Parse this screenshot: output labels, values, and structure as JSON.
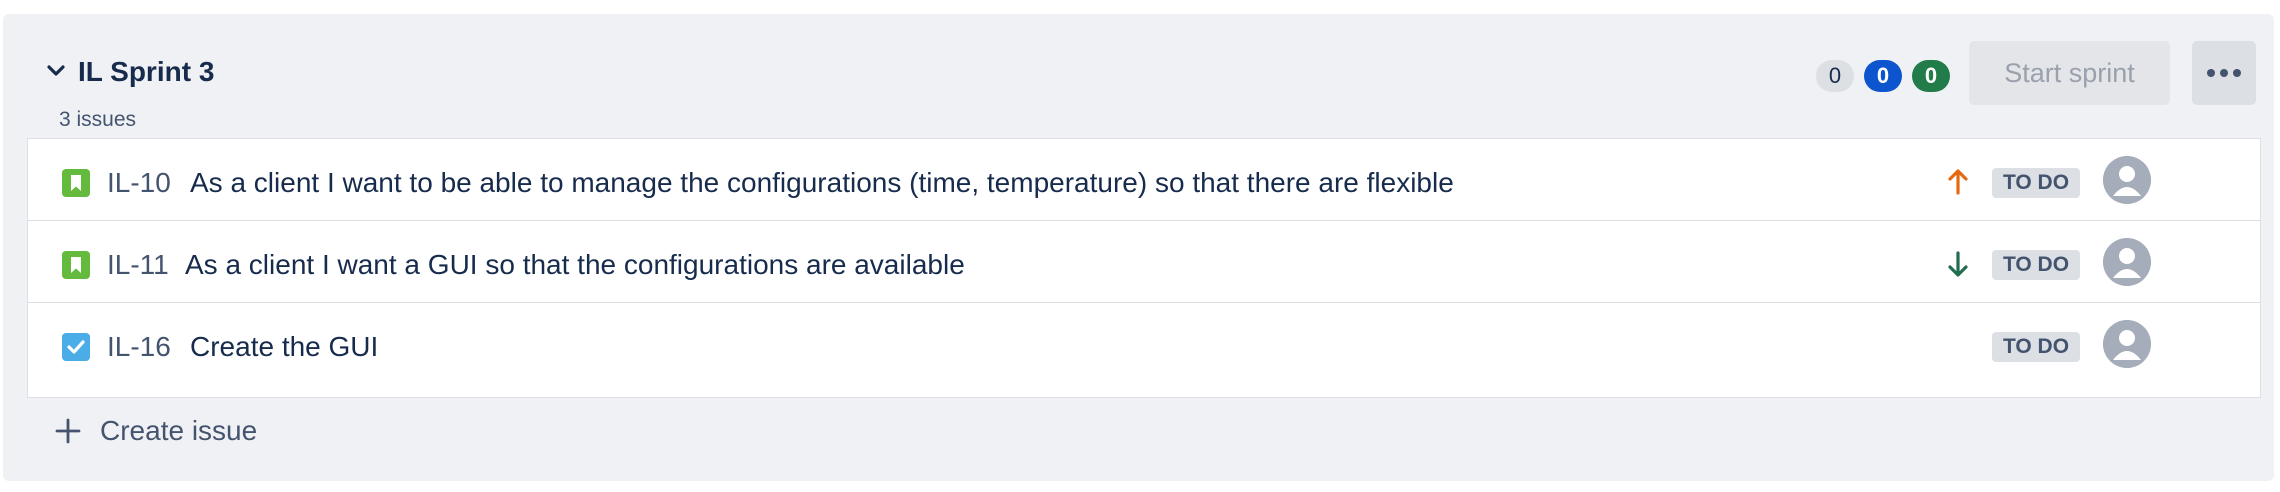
{
  "sprint": {
    "title": "IL Sprint 3",
    "issue_count": "3 issues",
    "counts": {
      "todo": "0",
      "in_progress": "0",
      "done": "0"
    },
    "start_button_label": "Start sprint"
  },
  "issues": [
    {
      "key": "IL-10",
      "summary": "As a client I want to be able to manage the configurations (time, temperature) so that there are flexible",
      "type": "story-icon",
      "priority": "high-priority-arrow-up-icon",
      "status": "TO DO"
    },
    {
      "key": "IL-11",
      "summary": "As a client I want a GUI so that the configurations are available",
      "type": "story-icon",
      "priority": "low-priority-arrow-down-icon",
      "status": "TO DO"
    },
    {
      "key": "IL-16",
      "summary": "Create the GUI",
      "type": "task-icon",
      "priority": "",
      "status": "TO DO"
    }
  ],
  "create_issue_label": "Create issue",
  "colors": {
    "story": "#63ba3c",
    "task": "#4bade8",
    "priority_high": "#e56910",
    "priority_low": "#216e4e",
    "count_blue": "#0c55cf",
    "count_green": "#217c4a"
  }
}
